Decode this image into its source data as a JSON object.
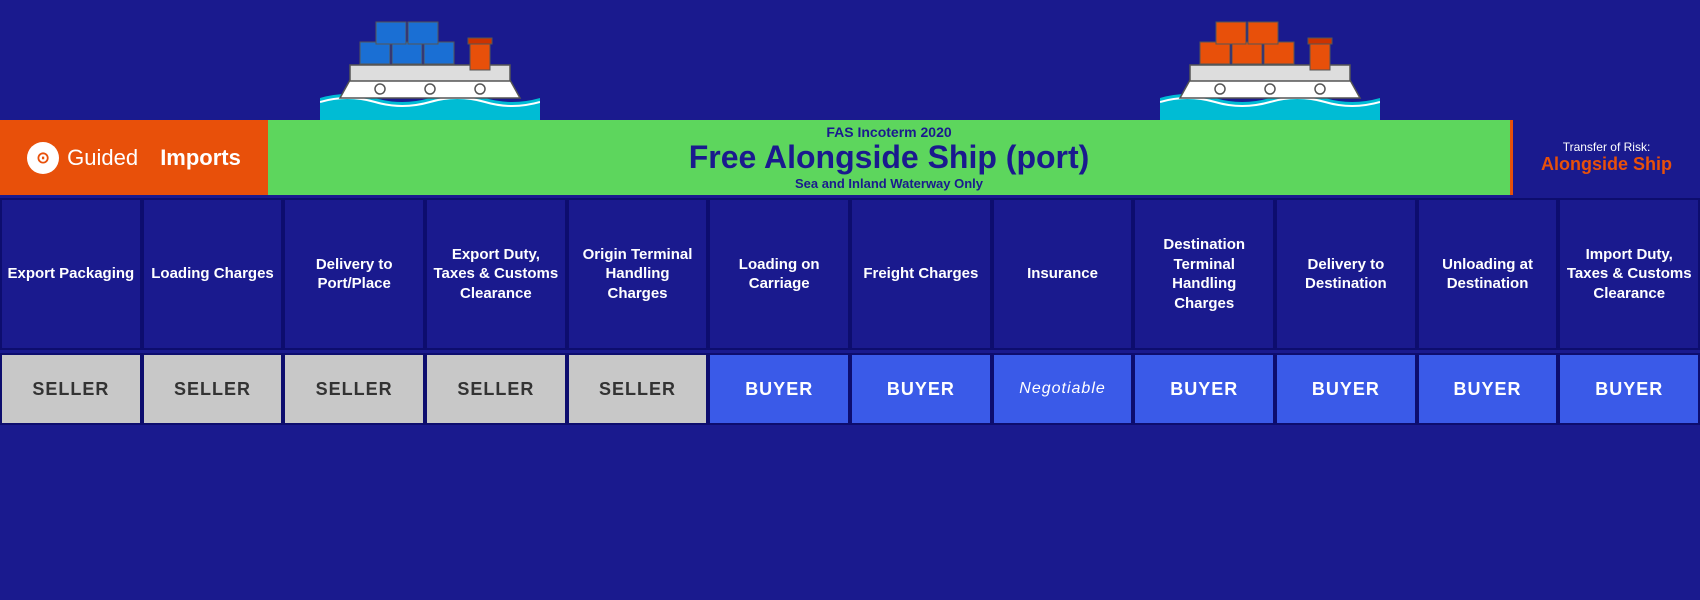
{
  "header": {
    "logo_name": "Guided Imports",
    "logo_bold": "Imports",
    "logo_plain": "Guided",
    "incoterm_label": "FAS Incoterm 2020",
    "incoterm_title": "Free Alongside Ship (port)",
    "incoterm_subtitle": "Sea and Inland Waterway Only",
    "risk_label": "Transfer of Risk:",
    "risk_value": "Alongside Ship"
  },
  "columns": [
    {
      "id": "export-packaging",
      "label": "Export Packaging",
      "responsibility": "SELLER",
      "type": "seller"
    },
    {
      "id": "loading-charges",
      "label": "Loading Charges",
      "responsibility": "SELLER",
      "type": "seller"
    },
    {
      "id": "delivery-port",
      "label": "Delivery to Port/Place",
      "responsibility": "SELLER",
      "type": "seller"
    },
    {
      "id": "export-duty",
      "label": "Export Duty, Taxes & Customs Clearance",
      "responsibility": "SELLER",
      "type": "seller"
    },
    {
      "id": "origin-terminal",
      "label": "Origin Terminal Handling Charges",
      "responsibility": "SELLER",
      "type": "seller"
    },
    {
      "id": "loading-on-carriage",
      "label": "Loading on Carriage",
      "responsibility": "BUYER",
      "type": "buyer"
    },
    {
      "id": "freight-charges",
      "label": "Freight Charges",
      "responsibility": "BUYER",
      "type": "buyer"
    },
    {
      "id": "insurance",
      "label": "Insurance",
      "responsibility": "Negotiable",
      "type": "negotiable"
    },
    {
      "id": "destination-terminal",
      "label": "Destination Terminal Handling Charges",
      "responsibility": "BUYER",
      "type": "buyer"
    },
    {
      "id": "delivery-destination",
      "label": "Delivery to Destination",
      "responsibility": "BUYER",
      "type": "buyer"
    },
    {
      "id": "unloading-destination",
      "label": "Unloading at Destination",
      "responsibility": "BUYER",
      "type": "buyer"
    },
    {
      "id": "import-duty",
      "label": "Import Duty, Taxes & Customs Clearance",
      "responsibility": "BUYER",
      "type": "buyer"
    }
  ],
  "colors": {
    "background": "#1a1a8e",
    "orange": "#e8500a",
    "green": "#5dd65d",
    "seller_bg": "#c8c8c8",
    "buyer_bg": "#3a5ae8"
  }
}
